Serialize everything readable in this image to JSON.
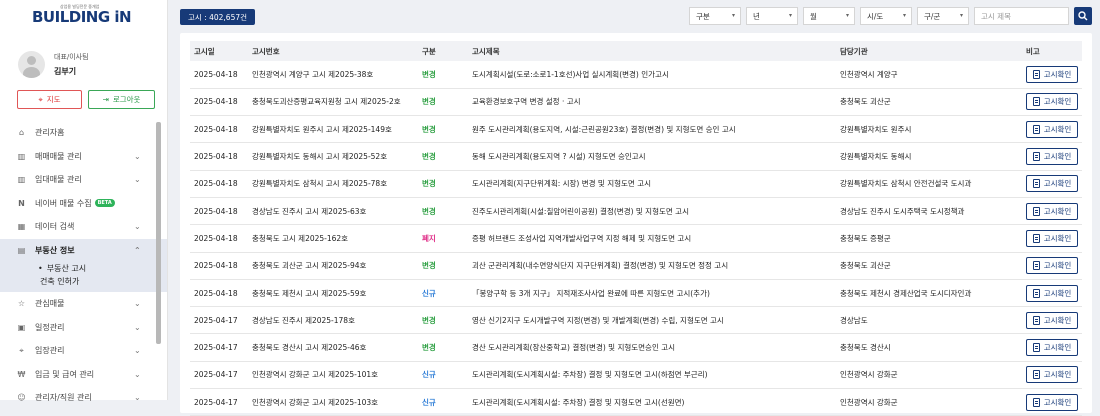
{
  "logo": {
    "tagline": "상업용 빌딩전문 중개업",
    "name": "BUILDING iN"
  },
  "profile": {
    "role": "대표/이사팀",
    "name": "김부기"
  },
  "buttons": {
    "map": "지도",
    "logout": "로그아웃"
  },
  "menu": [
    {
      "label": "관리자홈",
      "icon": "home-icon"
    },
    {
      "label": "매매매물 관리",
      "icon": "building-icon"
    },
    {
      "label": "임대매물 관리",
      "icon": "building-icon"
    },
    {
      "label": "네이버 매물 수집",
      "icon": "naver-icon",
      "badge": "BETA"
    },
    {
      "label": "데이터 검색",
      "icon": "grid-icon"
    },
    {
      "label": "부동산 정보",
      "icon": "document-icon"
    }
  ],
  "submenu": [
    "부동산 고시",
    "건축 인허가"
  ],
  "menu2": [
    {
      "label": "관심매물",
      "icon": "star-icon"
    },
    {
      "label": "일정관리",
      "icon": "calendar-icon"
    },
    {
      "label": "임장관리",
      "icon": "map-pin-icon"
    },
    {
      "label": "입금 및 급여 관리",
      "icon": "money-icon"
    },
    {
      "label": "관리자/직원 관리",
      "icon": "people-icon"
    }
  ],
  "count_label": "고시 : 402,657건",
  "filters": {
    "type": "구분",
    "year": "년",
    "month": "월",
    "province": "시/도",
    "district": "구/군",
    "search_placeholder": "고시 제목"
  },
  "table": {
    "headers": [
      "고시일",
      "고시번호",
      "구분",
      "고시제목",
      "담당기관",
      "비고"
    ],
    "button_label": "고시확인",
    "rows": [
      {
        "date": "2025-04-18",
        "no": "인천광역시 계양구 고시 제2025-38호",
        "kind": "변경",
        "kclass": "k-change",
        "title": "도시계획시설(도로:소로1-1호선)사업 실시계획(변경) 인가고시",
        "org": "인천광역시 계양구"
      },
      {
        "date": "2025-04-18",
        "no": "충청북도괴산증평교육지원청 고시 제2025-2호",
        "kind": "변경",
        "kclass": "k-change",
        "title": "교육환경보호구역 변경 설정 · 고시",
        "org": "충청북도 괴산군"
      },
      {
        "date": "2025-04-18",
        "no": "강원특별자치도 원주시 고시 제2025-149호",
        "kind": "변경",
        "kclass": "k-change",
        "title": "원주 도시관리계획(용도지역, 시설:근린공원23호) 결정(변경) 및 지형도면 승인 고시",
        "org": "강원특별자치도 원주시"
      },
      {
        "date": "2025-04-18",
        "no": "강원특별자치도 동해시 고시 제2025-52호",
        "kind": "변경",
        "kclass": "k-change",
        "title": "동해 도시관리계획(용도지역 ? 시설) 지형도면 승인고시",
        "org": "강원특별자치도 동해시"
      },
      {
        "date": "2025-04-18",
        "no": "강원특별자치도 삼척시 고시 제2025-78호",
        "kind": "변경",
        "kclass": "k-change",
        "title": "도시관리계획(지구단위계획: 시장) 변경 및 지형도면 고시",
        "org": "강원특별자치도 삼척시 안전건설국 도시과"
      },
      {
        "date": "2025-04-18",
        "no": "경상남도 진주시 고시 제2025-63호",
        "kind": "변경",
        "kclass": "k-change",
        "title": "진주도시관리계획(시설:칠암어린이공원) 결정(변경) 및 지형도면 고시",
        "org": "경상남도 진주시 도시주택국 도시정책과"
      },
      {
        "date": "2025-04-18",
        "no": "충청북도 고시 제2025-162호",
        "kind": "폐지",
        "kclass": "k-close",
        "title": "증평 허브랜드 조성사업 지역개발사업구역 지정 해제 및 지형도면 고시",
        "org": "충청북도 증평군"
      },
      {
        "date": "2025-04-18",
        "no": "충청북도 괴산군 고시 제2025-94호",
        "kind": "변경",
        "kclass": "k-change",
        "title": "괴산 군관리계획(내수면양식단지 지구단위계획) 결정(변경) 및 지형도면 정정 고시",
        "org": "충청북도 괴산군"
      },
      {
        "date": "2025-04-18",
        "no": "충청북도 제천시 고시 제2025-59호",
        "kind": "신규",
        "kclass": "k-new",
        "title": "「봉양구학 등 3개 지구」 지적재조사사업 완료에 따른 지형도면 고시(추가)",
        "org": "충청북도 제천시 경제산업국 도시디자인과"
      },
      {
        "date": "2025-04-17",
        "no": "경상남도 진주시 제2025-178호",
        "kind": "변경",
        "kclass": "k-change",
        "title": "영산 신기2지구 도시개발구역 지정(변경) 및 개발계획(변경) 수립, 지형도면 고시",
        "org": "경상남도"
      },
      {
        "date": "2025-04-17",
        "no": "충청북도 경산시 고시 제2025-46호",
        "kind": "변경",
        "kclass": "k-change",
        "title": "경산 도시관리계획(장산중학교) 결정(변경) 및 지형도면승인 고시",
        "org": "충청북도 경산시"
      },
      {
        "date": "2025-04-17",
        "no": "인천광역시 강화군 고시 제2025-101호",
        "kind": "신규",
        "kclass": "k-new",
        "title": "도시관리계획(도시계획시설: 주차장) 결정 및 지형도면 고시(하점면 부근리)",
        "org": "인천광역시 강화군"
      },
      {
        "date": "2025-04-17",
        "no": "인천광역시 강화군 고시 제2025-103호",
        "kind": "신규",
        "kclass": "k-new",
        "title": "도시관리계획(도시계획시설: 주차장) 결정 및 지형도면 고시(선원면)",
        "org": "인천광역시 강화군"
      }
    ]
  }
}
